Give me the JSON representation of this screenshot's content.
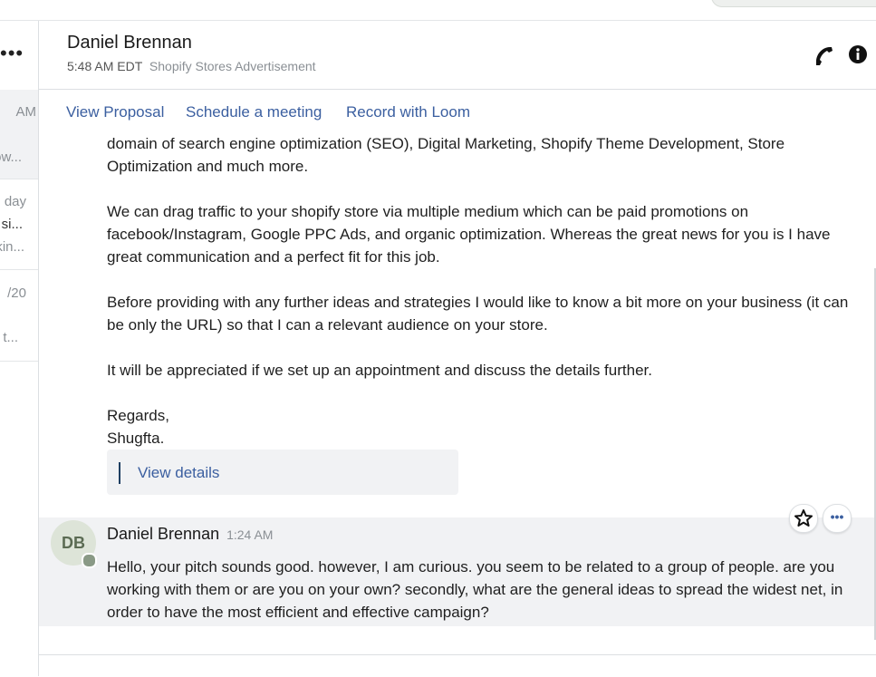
{
  "sidebar": {
    "more_label": "•••",
    "items": [
      {
        "time": "AM",
        "preview": "ow..."
      },
      {
        "time": "day",
        "preview": "si...",
        "preview2": "kin..."
      },
      {
        "time": "/20",
        "preview": "t..."
      }
    ]
  },
  "header": {
    "name": "Daniel Brennan",
    "time": "5:48 AM EDT",
    "subject": "Shopify Stores Advertisement",
    "phone_icon": "phone-icon",
    "info_icon": "info-icon"
  },
  "tabs": [
    "View Proposal",
    "Schedule a meeting",
    "Record with Loom"
  ],
  "message1": {
    "p1_line1": "domain of search engine optimization (SEO), Digital Marketing, Shopify Theme Development, Store",
    "p1_line2": "Optimization and much more.",
    "p2": "We can drag traffic to your shopify store via multiple medium which can be paid promotions on facebook/Instagram, Google PPC Ads, and organic optimization. Whereas the great news for you is I have great communication and a perfect fit for this job.",
    "p3": "Before providing with any further ideas and strategies I would like to know a bit more on your business (it can be only the URL) so that I can a relevant audience on your store.",
    "p4": "It will be appreciated if we set up an appointment and discuss the details further.",
    "sign1": "Regards,",
    "sign2": "Shugfta.",
    "details_label": "View details"
  },
  "message2": {
    "initials": "DB",
    "author": "Daniel Brennan",
    "time": "1:24 AM",
    "body": "Hello, your pitch sounds good. however, I am curious. you seem to be related to a group of people. are you working with them or are you on your own? secondly, what are the general ideas to spread the widest net, in order to have the most efficient and effective campaign?",
    "more_label": "•••"
  }
}
